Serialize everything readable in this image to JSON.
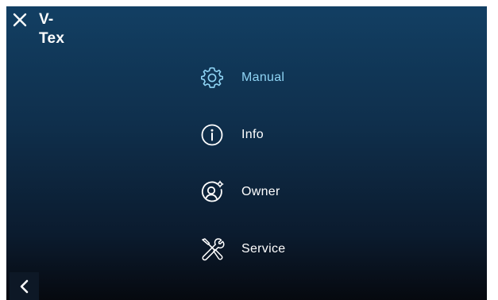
{
  "header": {
    "title": "V-Tex",
    "close_icon": "close-icon"
  },
  "menu": {
    "items": [
      {
        "label": "Manual",
        "icon": "gear-icon",
        "active": true
      },
      {
        "label": "Info",
        "icon": "info-icon",
        "active": false
      },
      {
        "label": "Owner",
        "icon": "user-settings-icon",
        "active": false
      },
      {
        "label": "Service",
        "icon": "tools-icon",
        "active": false
      }
    ]
  },
  "footer": {
    "back_icon": "chevron-left-icon"
  },
  "colors": {
    "active": "#8fd4f4",
    "text": "#ffffff",
    "bg_top": "#123f63",
    "bg_bottom": "#06090f"
  }
}
